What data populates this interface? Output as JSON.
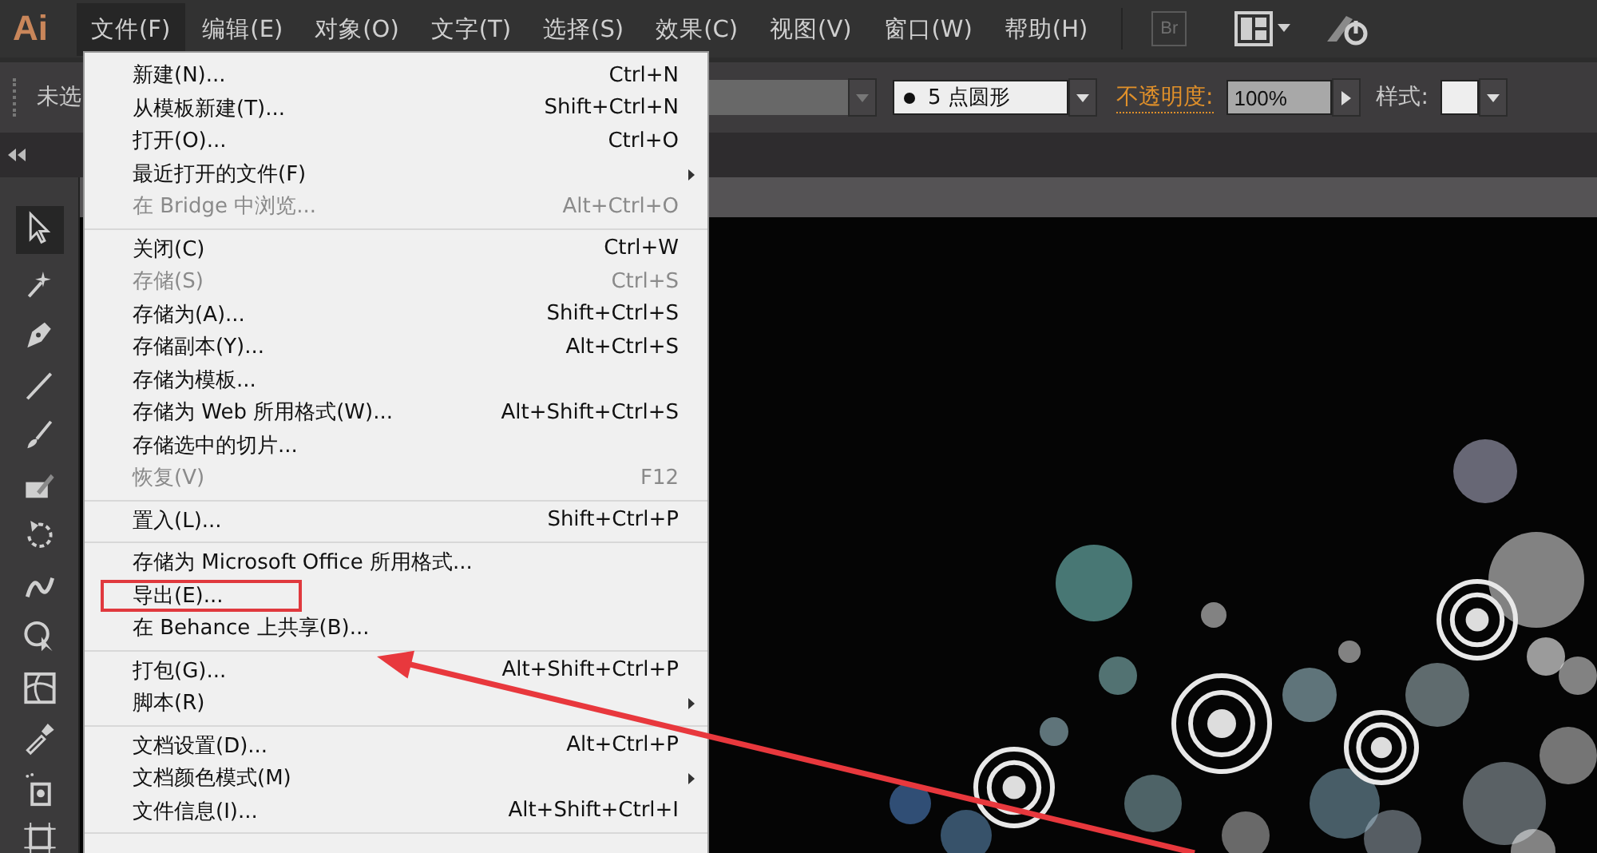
{
  "app": {
    "logo": "Ai"
  },
  "menubar": [
    {
      "label": "文件(F)",
      "selected": true
    },
    {
      "label": "编辑(E)",
      "selected": false
    },
    {
      "label": "对象(O)",
      "selected": false
    },
    {
      "label": "文字(T)",
      "selected": false
    },
    {
      "label": "选择(S)",
      "selected": false
    },
    {
      "label": "效果(C)",
      "selected": false
    },
    {
      "label": "视图(V)",
      "selected": false
    },
    {
      "label": "窗口(W)",
      "selected": false
    },
    {
      "label": "帮助(H)",
      "selected": false
    }
  ],
  "bridge_button": {
    "label": "Br"
  },
  "control_bar": {
    "selection_label": "未选",
    "brush_field": {
      "value": "5 点圆形"
    },
    "opacity_label": "不透明度:",
    "opacity_field": {
      "value": "100%"
    },
    "style_label": "样式:"
  },
  "file_menu": {
    "groups": [
      [
        {
          "label": "新建(N)...",
          "shortcut": "Ctrl+N",
          "disabled": false,
          "submenu": false,
          "marked": false
        },
        {
          "label": "从模板新建(T)...",
          "shortcut": "Shift+Ctrl+N",
          "disabled": false,
          "submenu": false,
          "marked": false
        },
        {
          "label": "打开(O)...",
          "shortcut": "Ctrl+O",
          "disabled": false,
          "submenu": false,
          "marked": false
        },
        {
          "label": "最近打开的文件(F)",
          "disabled": false,
          "submenu": true,
          "marked": false
        },
        {
          "label": "在 Bridge 中浏览...",
          "shortcut": "Alt+Ctrl+O",
          "disabled": true,
          "submenu": false,
          "marked": false
        }
      ],
      [
        {
          "label": "关闭(C)",
          "shortcut": "Ctrl+W",
          "disabled": false,
          "submenu": false,
          "marked": false
        },
        {
          "label": "存储(S)",
          "shortcut": "Ctrl+S",
          "disabled": true,
          "submenu": false,
          "marked": false
        },
        {
          "label": "存储为(A)...",
          "shortcut": "Shift+Ctrl+S",
          "disabled": false,
          "submenu": false,
          "marked": false
        },
        {
          "label": "存储副本(Y)...",
          "shortcut": "Alt+Ctrl+S",
          "disabled": false,
          "submenu": false,
          "marked": false
        },
        {
          "label": "存储为模板...",
          "disabled": false,
          "submenu": false,
          "marked": false
        },
        {
          "label": "存储为 Web 所用格式(W)...",
          "shortcut": "Alt+Shift+Ctrl+S",
          "disabled": false,
          "submenu": false,
          "marked": false
        },
        {
          "label": "存储选中的切片...",
          "disabled": false,
          "submenu": false,
          "marked": false
        },
        {
          "label": "恢复(V)",
          "shortcut": "F12",
          "disabled": true,
          "submenu": false,
          "marked": false
        }
      ],
      [
        {
          "label": "置入(L)...",
          "shortcut": "Shift+Ctrl+P",
          "disabled": false,
          "submenu": false,
          "marked": false
        }
      ],
      [
        {
          "label": "存储为 Microsoft Office 所用格式...",
          "disabled": false,
          "submenu": false,
          "marked": false
        },
        {
          "label": "导出(E)...",
          "disabled": false,
          "submenu": false,
          "marked": true
        },
        {
          "label": "在 Behance 上共享(B)...",
          "disabled": false,
          "submenu": false,
          "marked": false
        }
      ],
      [
        {
          "label": "打包(G)...",
          "shortcut": "Alt+Shift+Ctrl+P",
          "disabled": false,
          "submenu": false,
          "marked": false
        },
        {
          "label": "脚本(R)",
          "disabled": false,
          "submenu": true,
          "marked": false
        }
      ],
      [
        {
          "label": "文档设置(D)...",
          "shortcut": "Alt+Ctrl+P",
          "disabled": false,
          "submenu": false,
          "marked": false
        },
        {
          "label": "文档颜色模式(M)",
          "disabled": false,
          "submenu": true,
          "marked": false
        },
        {
          "label": "文件信息(I)...",
          "shortcut": "Alt+Shift+Ctrl+I",
          "disabled": false,
          "submenu": false,
          "marked": false
        }
      ]
    ]
  }
}
